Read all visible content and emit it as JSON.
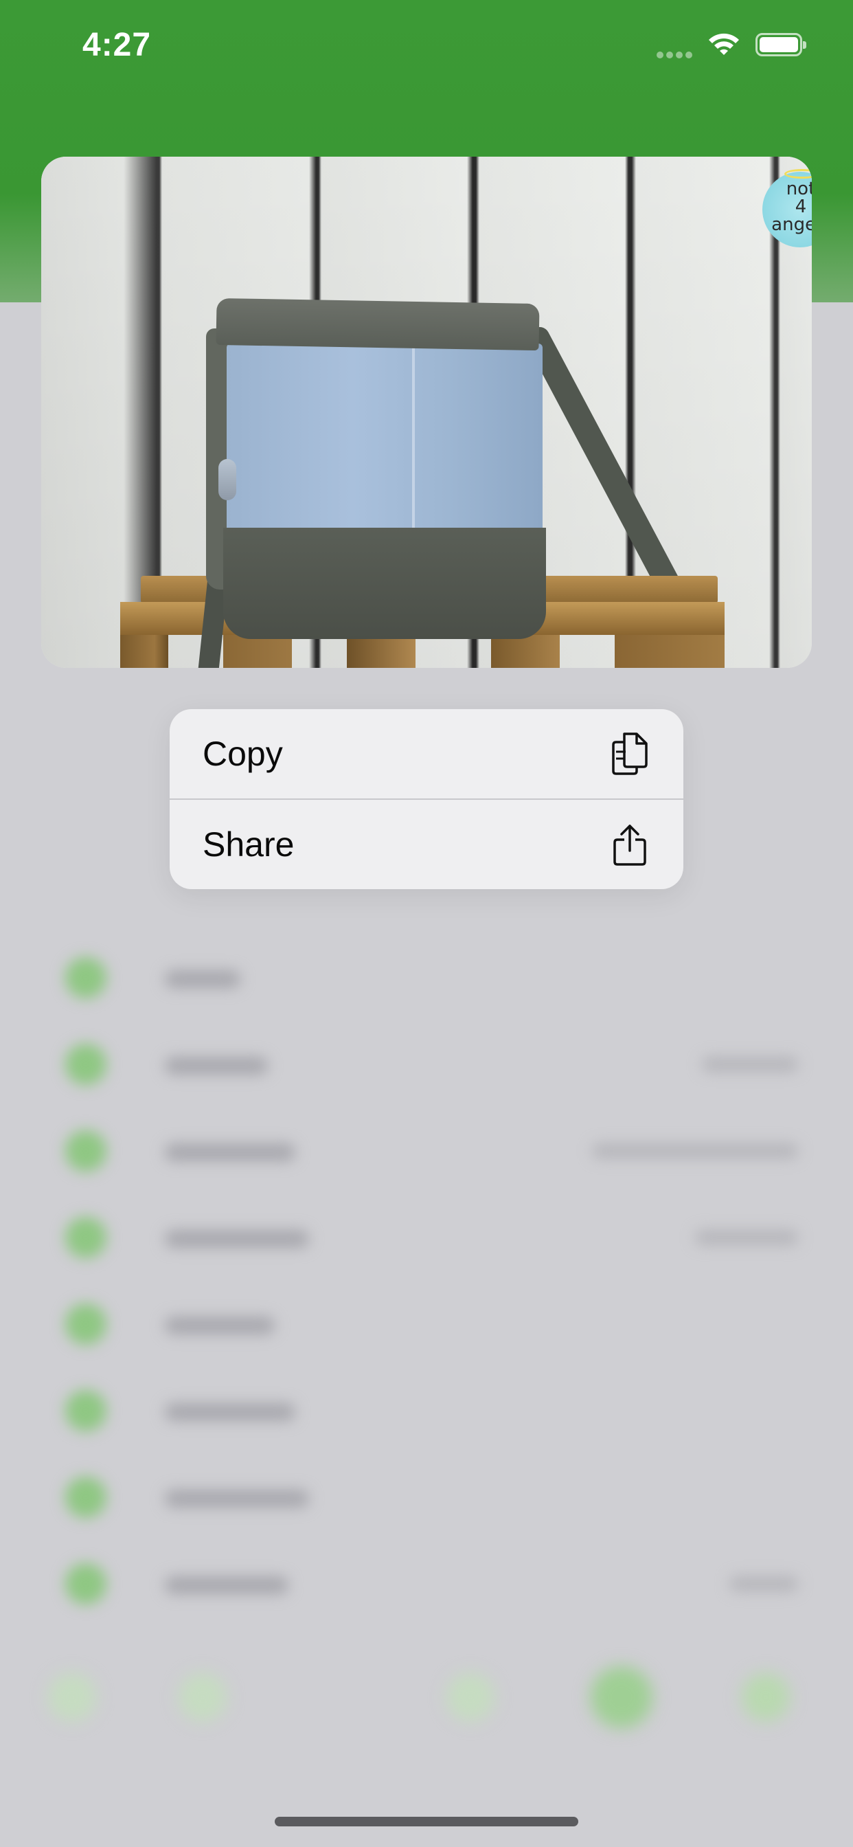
{
  "status_bar": {
    "time": "4:27"
  },
  "preview": {
    "logo_text": [
      "not",
      "4",
      "angels"
    ]
  },
  "context_menu": {
    "items": [
      {
        "label": "Copy",
        "icon": "copy-icon"
      },
      {
        "label": "Share",
        "icon": "share-icon"
      }
    ]
  },
  "colors": {
    "header_green": "#3c9a36",
    "menu_bg": "#efeff1",
    "dimmed_bg": "#cfcfd3"
  }
}
